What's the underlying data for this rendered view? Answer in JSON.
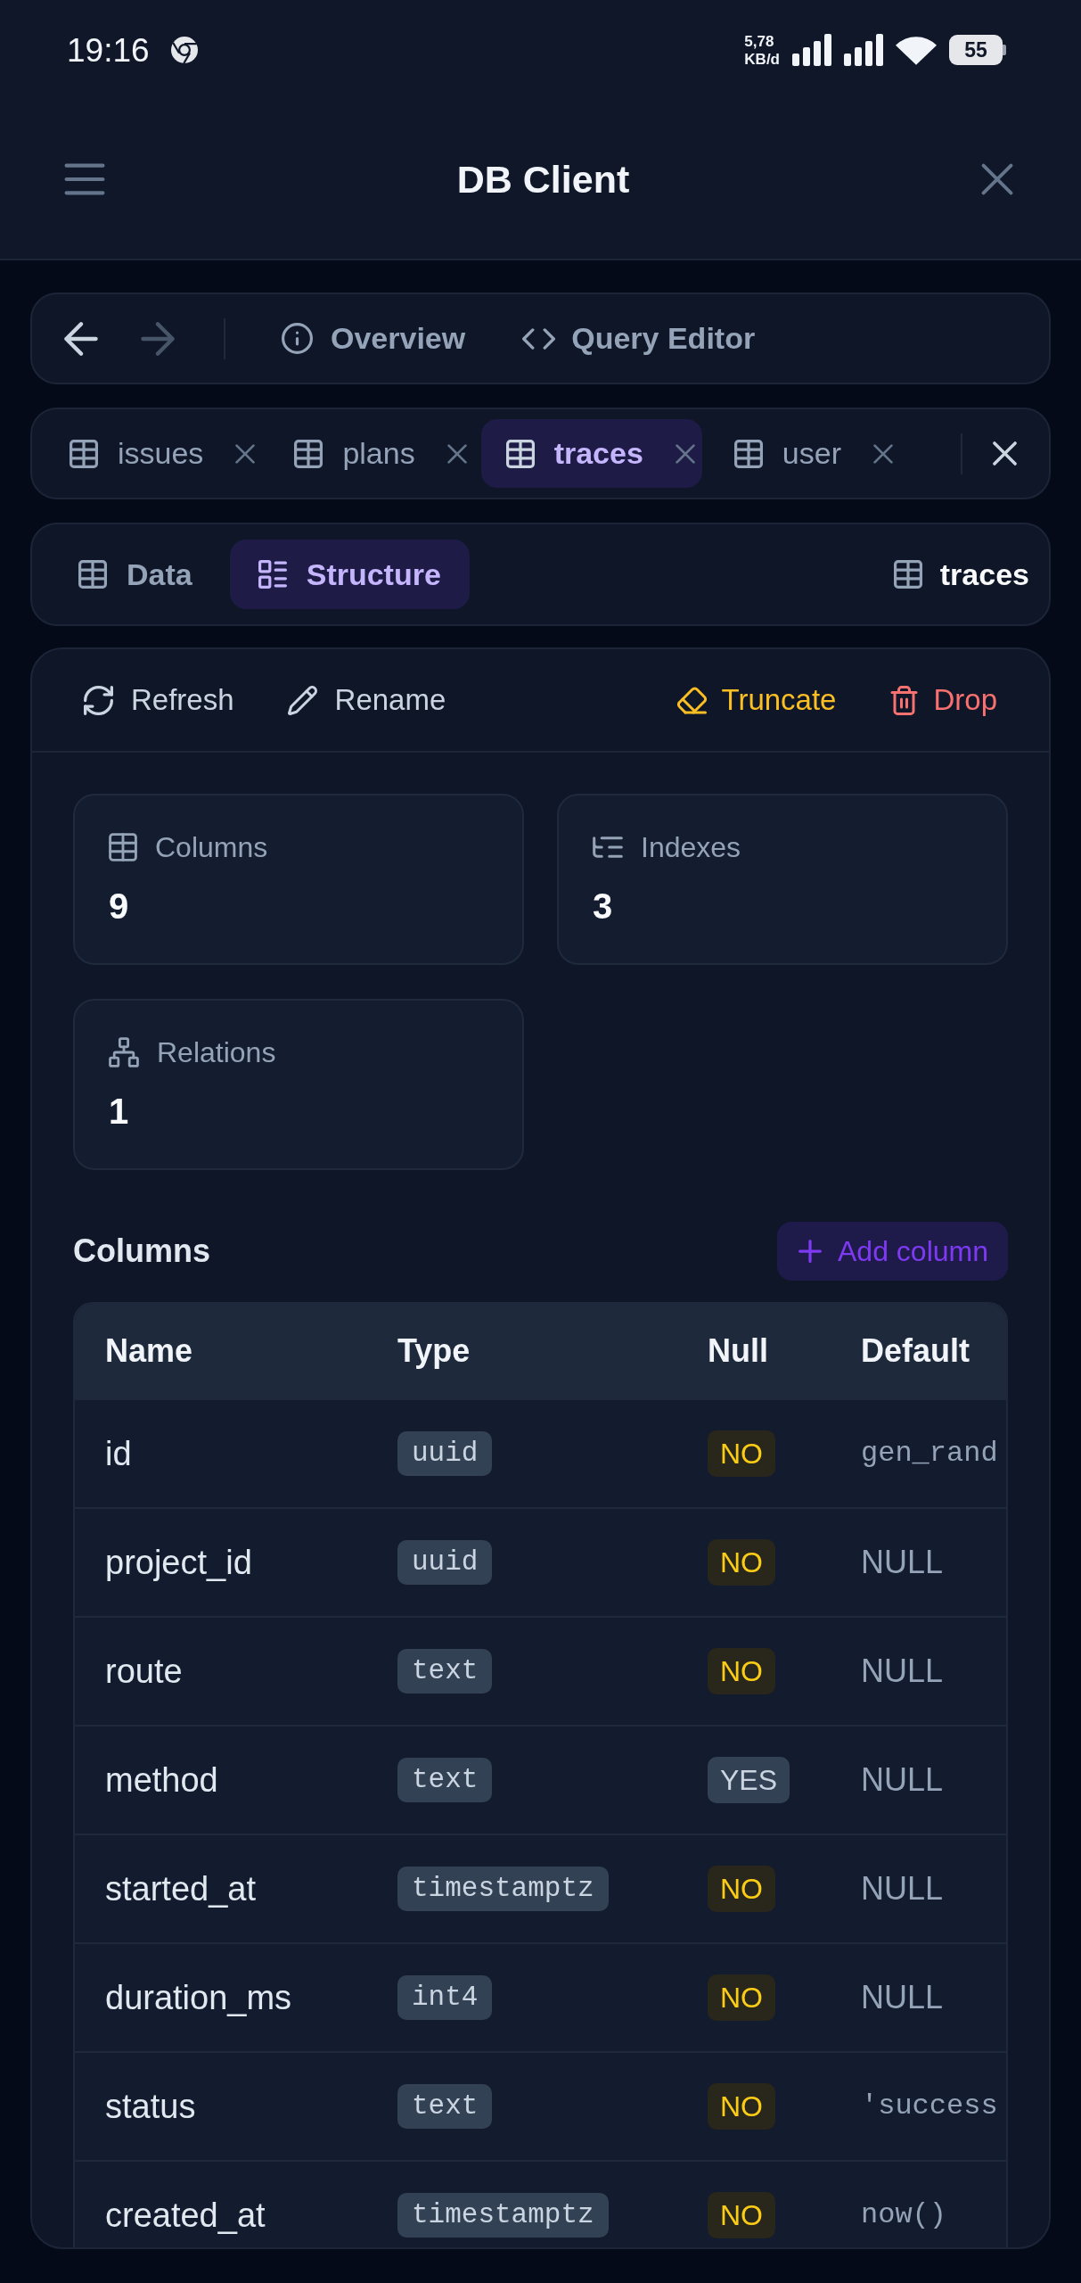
{
  "status_bar": {
    "time": "19:16",
    "net_speed": {
      "value": "5,78",
      "unit": "KB/d"
    },
    "battery": "55"
  },
  "app_bar": {
    "title": "DB Client"
  },
  "nav": {
    "back": {
      "disabled": false
    },
    "forward": {
      "disabled": true
    },
    "links": [
      {
        "kind": "overview",
        "label": "Overview"
      },
      {
        "kind": "editor",
        "label": "Query Editor"
      }
    ]
  },
  "table_tabs": [
    {
      "label": "issues",
      "selected": false
    },
    {
      "label": "plans",
      "selected": false
    },
    {
      "label": "traces",
      "selected": true
    },
    {
      "label": "user",
      "selected": false
    }
  ],
  "view_tabs": [
    {
      "kind": "data",
      "label": "Data",
      "selected": false
    },
    {
      "kind": "structure",
      "label": "Structure",
      "selected": true
    }
  ],
  "current_table": {
    "label": "traces"
  },
  "toolbar": [
    {
      "kind": "refresh",
      "label": "Refresh"
    },
    {
      "kind": "rename",
      "label": "Rename"
    },
    {
      "kind": "truncate",
      "label": "Truncate"
    },
    {
      "kind": "drop",
      "label": "Drop"
    }
  ],
  "stats": [
    {
      "kind": "columns",
      "label": "Columns",
      "value": "9"
    },
    {
      "kind": "indexes",
      "label": "Indexes",
      "value": "3"
    },
    {
      "kind": "relations",
      "label": "Relations",
      "value": "1"
    }
  ],
  "columns_section": {
    "title": "Columns",
    "add_button": "Add column"
  },
  "table": {
    "columns": [
      "Name",
      "Type",
      "Null",
      "Default"
    ],
    "rows": [
      {
        "name": "id",
        "type": "uuid",
        "null": "NO",
        "nullable": false,
        "default": {
          "kind": "expression",
          "text": "gen_rand"
        }
      },
      {
        "name": "project_id",
        "type": "uuid",
        "null": "NO",
        "nullable": false,
        "default": {
          "kind": "null",
          "text": "NULL"
        }
      },
      {
        "name": "route",
        "type": "text",
        "null": "NO",
        "nullable": false,
        "default": {
          "kind": "null",
          "text": "NULL"
        }
      },
      {
        "name": "method",
        "type": "text",
        "null": "YES",
        "nullable": true,
        "default": {
          "kind": "null",
          "text": "NULL"
        }
      },
      {
        "name": "started_at",
        "type": "timestamptz",
        "null": "NO",
        "nullable": false,
        "default": {
          "kind": "null",
          "text": "NULL"
        }
      },
      {
        "name": "duration_ms",
        "type": "int4",
        "null": "NO",
        "nullable": false,
        "default": {
          "kind": "null",
          "text": "NULL"
        }
      },
      {
        "name": "status",
        "type": "text",
        "null": "NO",
        "nullable": false,
        "default": {
          "kind": "expression",
          "text": "'success"
        }
      },
      {
        "name": "created_at",
        "type": "timestamptz",
        "null": "NO",
        "nullable": false,
        "default": {
          "kind": "expression",
          "text": "now()"
        }
      }
    ]
  }
}
